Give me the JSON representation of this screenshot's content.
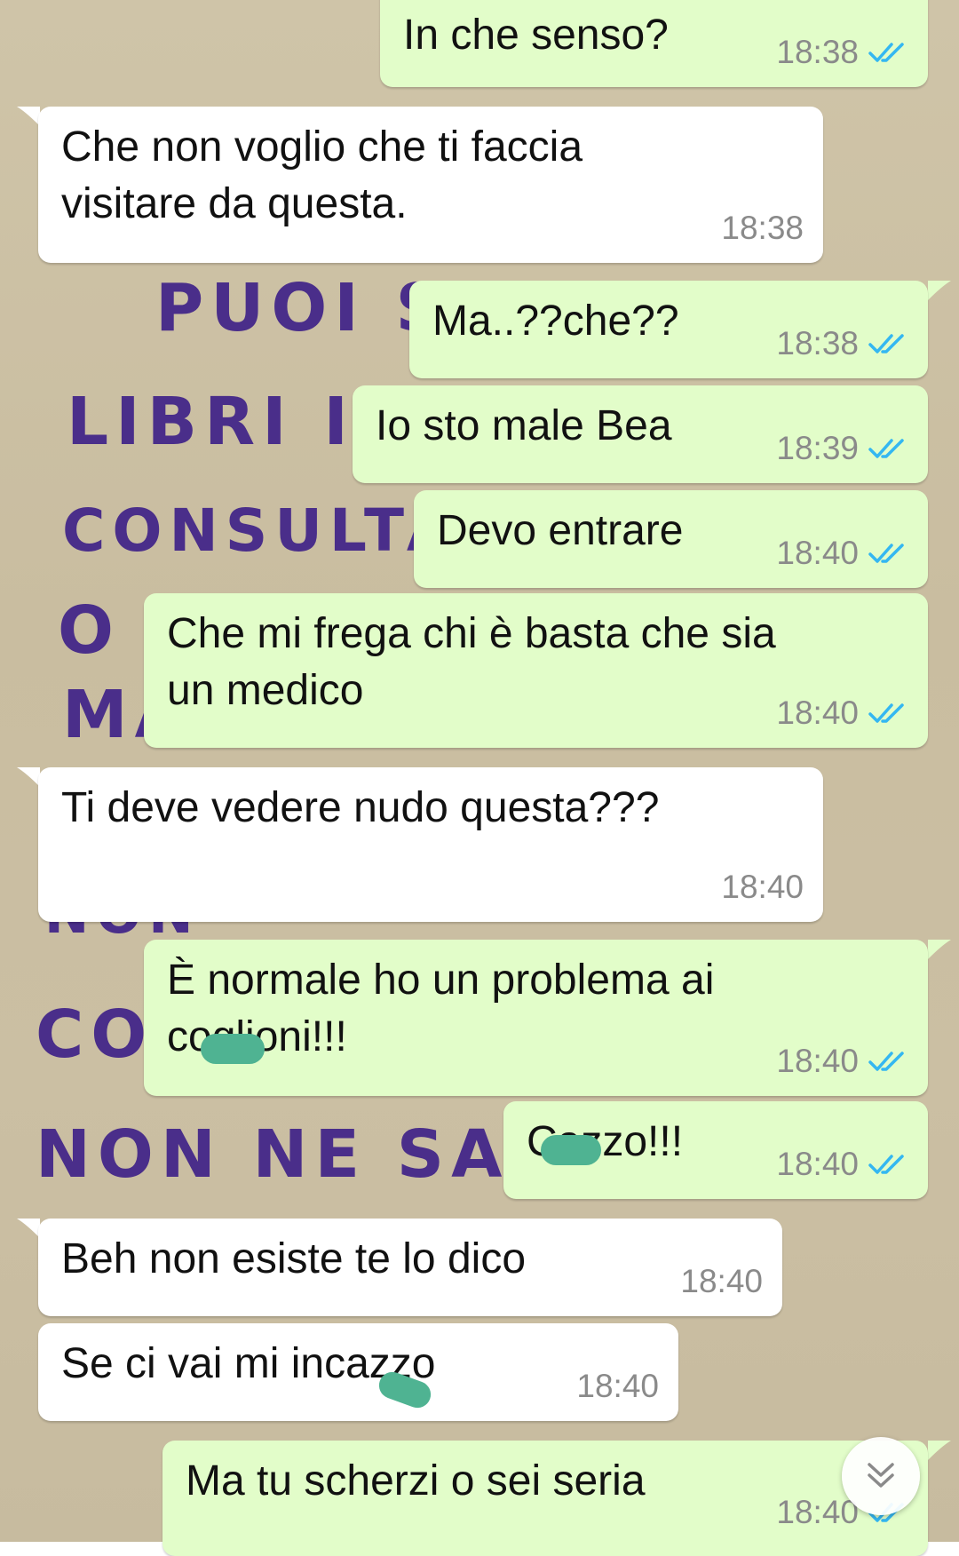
{
  "app": {
    "colors": {
      "outgoing_bubble": "#e2fdc9",
      "incoming_bubble": "#ffffff",
      "read_ticks": "#34b7f1",
      "timestamp": "#8a8a8a",
      "censor_mark": "#4fb392"
    },
    "read_icon": "double-check-icon",
    "scroll_icon": "chevron-double-down-icon"
  },
  "wallpaper": {
    "lines": [
      "PUOI S",
      "LIBRI IN",
      "CONSULTA",
      "O",
      "MA",
      "NON",
      "CO",
      "NON  NE  SA"
    ]
  },
  "messages": [
    {
      "direction": "out",
      "text": "In che senso?",
      "time": "18:38",
      "status": "read"
    },
    {
      "direction": "in",
      "text": "Che non voglio che ti faccia\nvisitare da questa.",
      "time": "18:38"
    },
    {
      "direction": "out",
      "text": "Ma..??che??",
      "time": "18:38",
      "status": "read"
    },
    {
      "direction": "out",
      "text": "Io sto male Bea",
      "time": "18:39",
      "status": "read"
    },
    {
      "direction": "out",
      "text": "Devo entrare",
      "time": "18:40",
      "status": "read"
    },
    {
      "direction": "out",
      "text": "Che mi frega chi è basta che sia\nun medico",
      "time": "18:40",
      "status": "read"
    },
    {
      "direction": "in",
      "text": "Ti deve vedere nudo questa???",
      "time": "18:40"
    },
    {
      "direction": "out",
      "text": "È normale ho un problema ai\ncoglioni!!!",
      "time": "18:40",
      "status": "read"
    },
    {
      "direction": "out",
      "text": "Cazzo!!!",
      "time": "18:40",
      "status": "read"
    },
    {
      "direction": "in",
      "text": "Beh non esiste te lo dico",
      "time": "18:40"
    },
    {
      "direction": "in",
      "text": "Se ci vai mi incazzo",
      "time": "18:40"
    },
    {
      "direction": "out",
      "text": "Ma tu scherzi o sei seria",
      "time": "18:40",
      "status": "read"
    }
  ]
}
